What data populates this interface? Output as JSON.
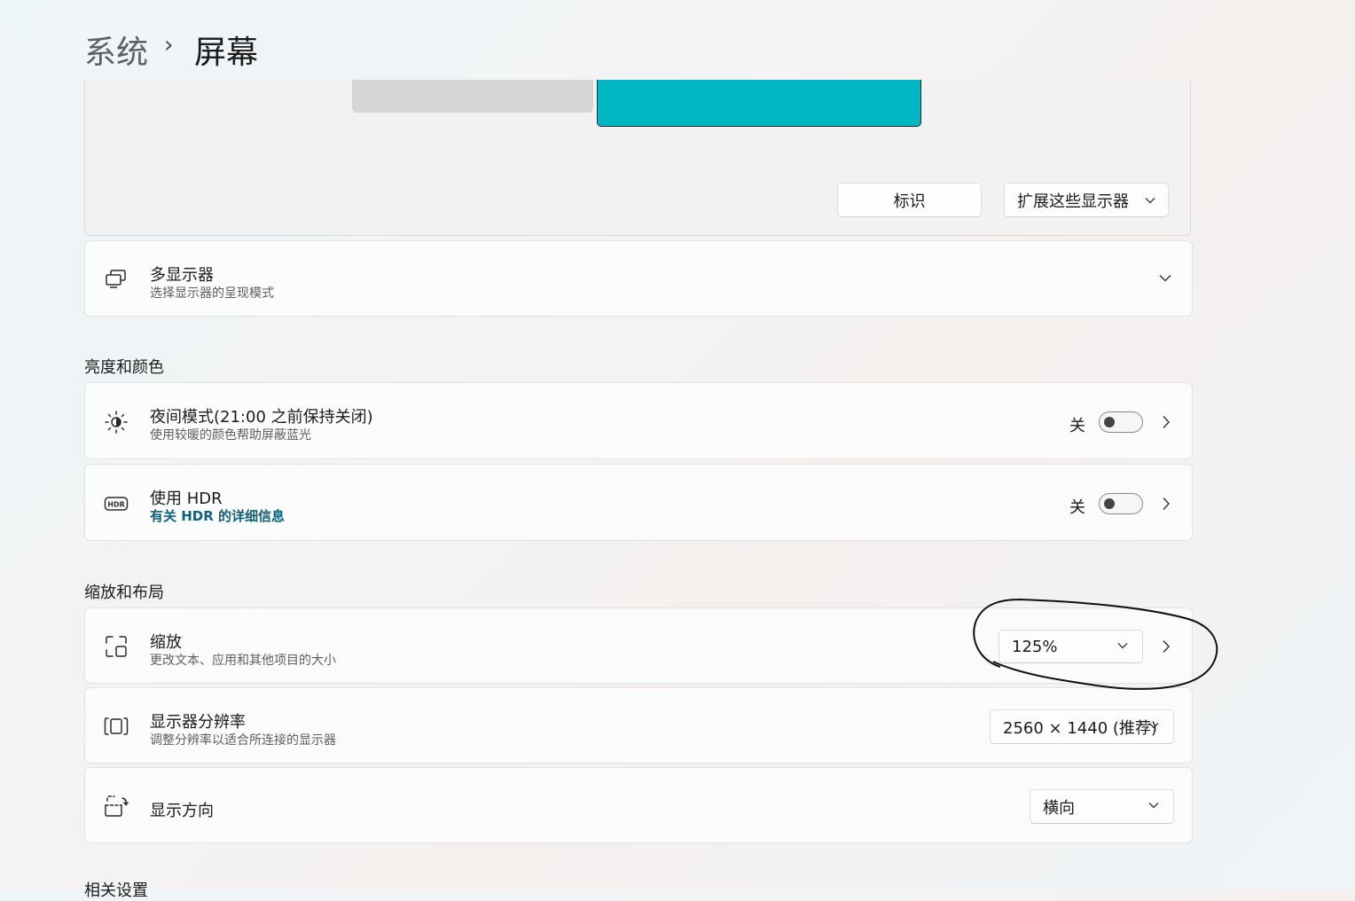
{
  "breadcrumb": {
    "parent": "系统",
    "separator": "›",
    "current": "屏幕"
  },
  "arrangement": {
    "identify_label": "标识",
    "extend_label": "扩展这些显示器",
    "selected_display_color": "#00b7c3"
  },
  "multi_display": {
    "title": "多显示器",
    "subtitle": "选择显示器的呈现模式"
  },
  "brightness_section": {
    "heading": "亮度和颜色"
  },
  "night_mode": {
    "title": "夜间模式(21:00 之前保持关闭)",
    "subtitle": "使用较暖的颜色帮助屏蔽蓝光",
    "state": "关"
  },
  "hdr": {
    "title": "使用 HDR",
    "link": "有关 HDR 的详细信息",
    "state": "关"
  },
  "scale_section": {
    "heading": "缩放和布局"
  },
  "scale": {
    "title": "缩放",
    "subtitle": "更改文本、应用和其他项目的大小",
    "value": "125%"
  },
  "resolution": {
    "title": "显示器分辨率",
    "subtitle": "调整分辨率以适合所连接的显示器",
    "value": "2560 × 1440 (推荐)"
  },
  "orientation": {
    "title": "显示方向",
    "value": "横向"
  },
  "related_section": {
    "heading": "相关设置"
  }
}
